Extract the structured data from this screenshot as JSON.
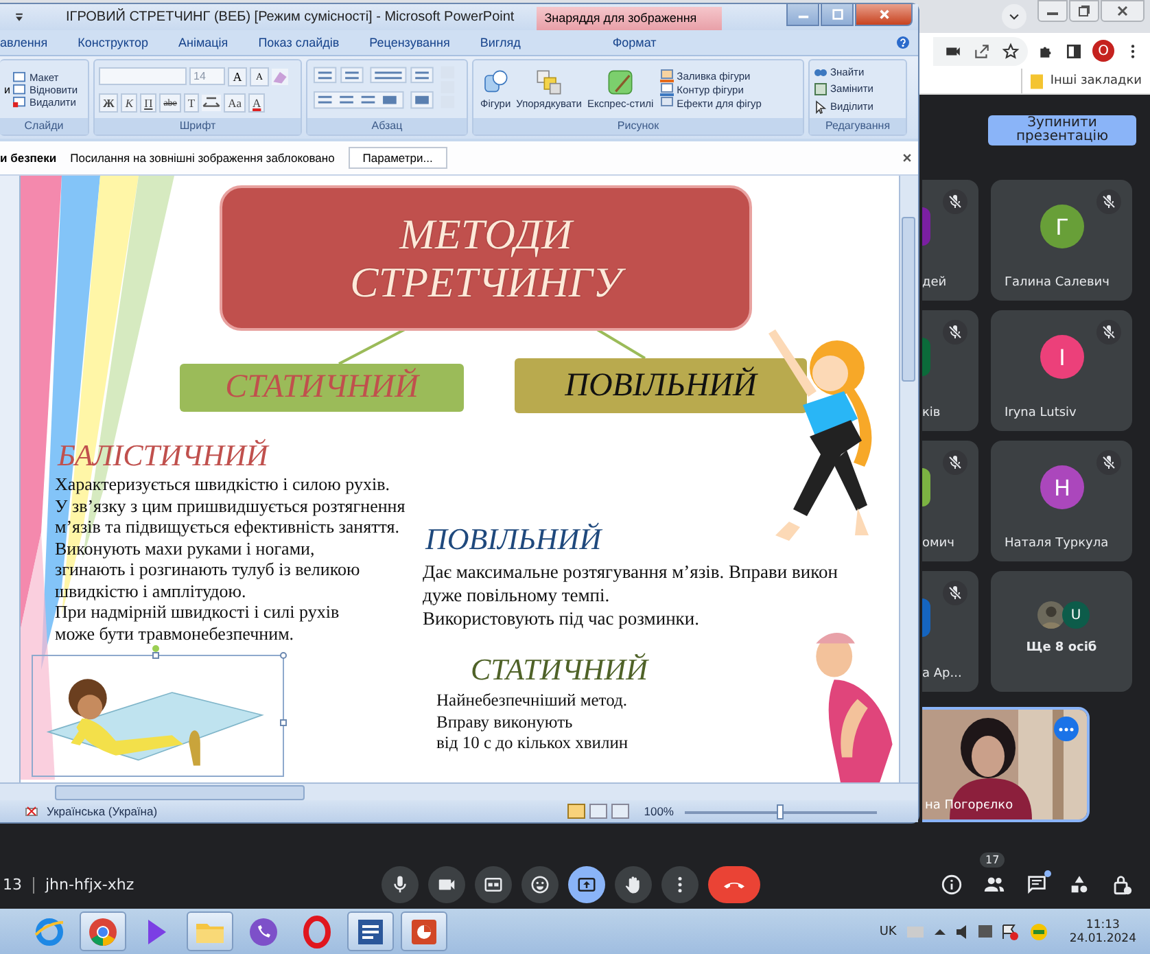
{
  "powerpoint": {
    "title": "ІГРОВИЙ СТРЕТЧИНГ (ВЕБ) [Режим сумісності] - Microsoft PowerPoint",
    "context_tab": "Знаряддя для зображення",
    "tabs": [
      {
        "label": "авлення"
      },
      {
        "label": "Конструктор"
      },
      {
        "label": "Анімація"
      },
      {
        "label": "Показ слайдів"
      },
      {
        "label": "Рецензування"
      },
      {
        "label": "Вигляд"
      },
      {
        "label": "Формат"
      }
    ],
    "slides_group": {
      "cut_label": "и",
      "items": [
        "Макет",
        "Відновити",
        "Видалити"
      ],
      "label": "Слайди"
    },
    "font_group": {
      "size": "14",
      "grow": "A",
      "shrink": "A",
      "styles": [
        "Ж",
        "К",
        "П",
        "abe",
        "Т"
      ],
      "case": "Aa",
      "color_letter": "A",
      "label": "Шрифт"
    },
    "paragraph_group": {
      "label": "Абзац"
    },
    "drawing_group": {
      "big": [
        "Фігури",
        "Упорядкувати",
        "Експрес-стилі"
      ],
      "small": [
        "Заливка фігури",
        "Контур фігури",
        "Ефекти для фігур"
      ],
      "label": "Рисунок"
    },
    "editing_group": {
      "items": [
        "Знайти",
        "Замінити",
        "Виділити"
      ],
      "label": "Редагування"
    },
    "security_bar": {
      "cut_label": "и безпеки",
      "message": "Посилання на зовнішні зображення заблоковано",
      "button": "Параметри..."
    },
    "slide": {
      "title_lines": [
        "МЕТОДИ",
        "СТРЕТЧИНГУ"
      ],
      "branches": [
        {
          "label": "СТАТИЧНИЙ",
          "color": "#9bbb59"
        },
        {
          "label": "ПОВІЛЬНИЙ",
          "color": "#b9aa4e"
        }
      ],
      "sections": [
        {
          "heading": "БАЛІСТИЧНИЙ",
          "color": "#c0504d",
          "lines": [
            "Характеризується швидкістю і силою рухів.",
            "У зв’язку з цим пришвидшується розтягнення",
            "м’язів та підвищується ефективність заняття.",
            "Виконують махи руками і ногами,",
            "згинають і розгинають тулуб із великою",
            "швидкістю і амплітудою.",
            "При надмірній швидкості і силі рухів",
            "може бути травмонебезпечним."
          ]
        },
        {
          "heading": "ПОВІЛЬНИЙ",
          "color": "#1f497d",
          "lines": [
            "Дає максимальне розтягування м’язів. Вправи викон",
            "дуже повільному темпі.",
            "Використовують під час розминки."
          ]
        },
        {
          "heading": "СТАТИЧНИЙ",
          "color": "#4f6228",
          "lines": [
            "Найнебезпечніший метод.",
            "Вправу виконують",
            "від 10 с до кількох хвилин"
          ]
        }
      ]
    },
    "status_bar": {
      "language": "Українська (Україна)",
      "zoom": "100%",
      "zoom_slider": {
        "level": 0.5
      }
    }
  },
  "browser": {
    "avatar": "O",
    "bookmarks": "Інші закладки",
    "stop_button": "Зупинити презентацію"
  },
  "meet": {
    "tiles": [
      {
        "name": "дей",
        "kind": "partial",
        "color": "#7b1fa2",
        "muted": true
      },
      {
        "name": "Галина Салевич",
        "kind": "avatar",
        "initial": "Г",
        "color": "#689f38",
        "muted": true
      },
      {
        "name": "ків",
        "kind": "partial",
        "color": "#0b6b3a",
        "muted": true
      },
      {
        "name": "Iryna Lutsiv",
        "kind": "avatar",
        "initial": "I",
        "color": "#ec407a",
        "muted": true
      },
      {
        "name": "омич",
        "kind": "partial",
        "color": "#7cb342",
        "muted": true
      },
      {
        "name": "Наталя Туркула",
        "kind": "avatar",
        "initial": "Н",
        "color": "#ab47bc",
        "muted": true
      },
      {
        "name": "а Ар...",
        "kind": "partial",
        "color": "#1565c0",
        "muted": true
      },
      {
        "name": "Ще 8 осіб",
        "kind": "more",
        "initial": "U",
        "color": "#0d5c4a",
        "muted": false
      }
    ],
    "self_view": {
      "name": "на Погорєлко"
    },
    "meeting_prefix": "13",
    "meeting_code": "jhn-hfjx-xhz",
    "people_count": "17"
  },
  "taskbar": {
    "language": "UK",
    "time": "11:13",
    "date": "24.01.2024"
  }
}
